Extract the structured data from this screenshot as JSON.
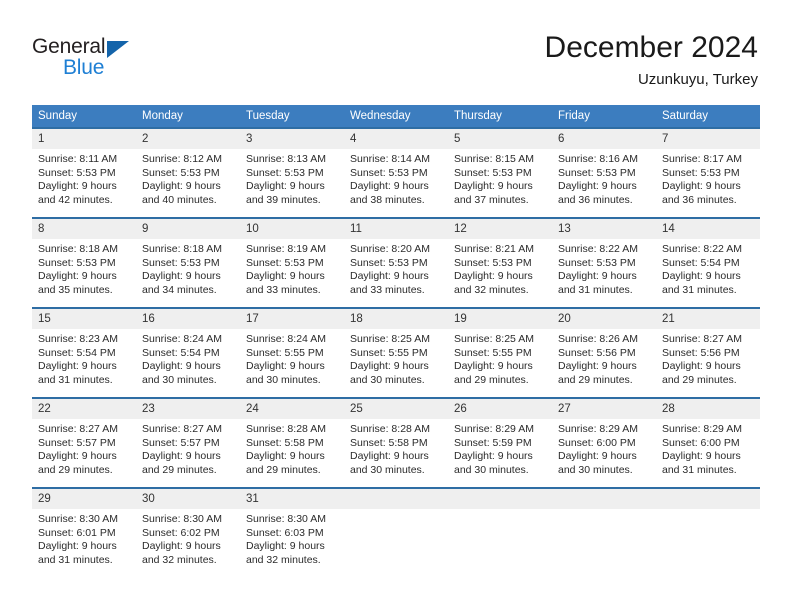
{
  "brand": {
    "name_top": "General",
    "name_bottom": "Blue",
    "accent_color": "#1e7fd4",
    "triangle_color": "#1464aa"
  },
  "header": {
    "title": "December 2024",
    "subtitle": "Uzunkuyu, Turkey"
  },
  "theme": {
    "header_bg": "#3c7dbf",
    "row_border": "#2e6da4",
    "daynum_bg": "#efefef"
  },
  "weekday_headers": [
    "Sunday",
    "Monday",
    "Tuesday",
    "Wednesday",
    "Thursday",
    "Friday",
    "Saturday"
  ],
  "weeks": [
    {
      "days": [
        {
          "num": "1",
          "sunrise": "Sunrise: 8:11 AM",
          "sunset": "Sunset: 5:53 PM",
          "daylight_line1": "Daylight: 9 hours",
          "daylight_line2": "and 42 minutes."
        },
        {
          "num": "2",
          "sunrise": "Sunrise: 8:12 AM",
          "sunset": "Sunset: 5:53 PM",
          "daylight_line1": "Daylight: 9 hours",
          "daylight_line2": "and 40 minutes."
        },
        {
          "num": "3",
          "sunrise": "Sunrise: 8:13 AM",
          "sunset": "Sunset: 5:53 PM",
          "daylight_line1": "Daylight: 9 hours",
          "daylight_line2": "and 39 minutes."
        },
        {
          "num": "4",
          "sunrise": "Sunrise: 8:14 AM",
          "sunset": "Sunset: 5:53 PM",
          "daylight_line1": "Daylight: 9 hours",
          "daylight_line2": "and 38 minutes."
        },
        {
          "num": "5",
          "sunrise": "Sunrise: 8:15 AM",
          "sunset": "Sunset: 5:53 PM",
          "daylight_line1": "Daylight: 9 hours",
          "daylight_line2": "and 37 minutes."
        },
        {
          "num": "6",
          "sunrise": "Sunrise: 8:16 AM",
          "sunset": "Sunset: 5:53 PM",
          "daylight_line1": "Daylight: 9 hours",
          "daylight_line2": "and 36 minutes."
        },
        {
          "num": "7",
          "sunrise": "Sunrise: 8:17 AM",
          "sunset": "Sunset: 5:53 PM",
          "daylight_line1": "Daylight: 9 hours",
          "daylight_line2": "and 36 minutes."
        }
      ]
    },
    {
      "days": [
        {
          "num": "8",
          "sunrise": "Sunrise: 8:18 AM",
          "sunset": "Sunset: 5:53 PM",
          "daylight_line1": "Daylight: 9 hours",
          "daylight_line2": "and 35 minutes."
        },
        {
          "num": "9",
          "sunrise": "Sunrise: 8:18 AM",
          "sunset": "Sunset: 5:53 PM",
          "daylight_line1": "Daylight: 9 hours",
          "daylight_line2": "and 34 minutes."
        },
        {
          "num": "10",
          "sunrise": "Sunrise: 8:19 AM",
          "sunset": "Sunset: 5:53 PM",
          "daylight_line1": "Daylight: 9 hours",
          "daylight_line2": "and 33 minutes."
        },
        {
          "num": "11",
          "sunrise": "Sunrise: 8:20 AM",
          "sunset": "Sunset: 5:53 PM",
          "daylight_line1": "Daylight: 9 hours",
          "daylight_line2": "and 33 minutes."
        },
        {
          "num": "12",
          "sunrise": "Sunrise: 8:21 AM",
          "sunset": "Sunset: 5:53 PM",
          "daylight_line1": "Daylight: 9 hours",
          "daylight_line2": "and 32 minutes."
        },
        {
          "num": "13",
          "sunrise": "Sunrise: 8:22 AM",
          "sunset": "Sunset: 5:53 PM",
          "daylight_line1": "Daylight: 9 hours",
          "daylight_line2": "and 31 minutes."
        },
        {
          "num": "14",
          "sunrise": "Sunrise: 8:22 AM",
          "sunset": "Sunset: 5:54 PM",
          "daylight_line1": "Daylight: 9 hours",
          "daylight_line2": "and 31 minutes."
        }
      ]
    },
    {
      "days": [
        {
          "num": "15",
          "sunrise": "Sunrise: 8:23 AM",
          "sunset": "Sunset: 5:54 PM",
          "daylight_line1": "Daylight: 9 hours",
          "daylight_line2": "and 31 minutes."
        },
        {
          "num": "16",
          "sunrise": "Sunrise: 8:24 AM",
          "sunset": "Sunset: 5:54 PM",
          "daylight_line1": "Daylight: 9 hours",
          "daylight_line2": "and 30 minutes."
        },
        {
          "num": "17",
          "sunrise": "Sunrise: 8:24 AM",
          "sunset": "Sunset: 5:55 PM",
          "daylight_line1": "Daylight: 9 hours",
          "daylight_line2": "and 30 minutes."
        },
        {
          "num": "18",
          "sunrise": "Sunrise: 8:25 AM",
          "sunset": "Sunset: 5:55 PM",
          "daylight_line1": "Daylight: 9 hours",
          "daylight_line2": "and 30 minutes."
        },
        {
          "num": "19",
          "sunrise": "Sunrise: 8:25 AM",
          "sunset": "Sunset: 5:55 PM",
          "daylight_line1": "Daylight: 9 hours",
          "daylight_line2": "and 29 minutes."
        },
        {
          "num": "20",
          "sunrise": "Sunrise: 8:26 AM",
          "sunset": "Sunset: 5:56 PM",
          "daylight_line1": "Daylight: 9 hours",
          "daylight_line2": "and 29 minutes."
        },
        {
          "num": "21",
          "sunrise": "Sunrise: 8:27 AM",
          "sunset": "Sunset: 5:56 PM",
          "daylight_line1": "Daylight: 9 hours",
          "daylight_line2": "and 29 minutes."
        }
      ]
    },
    {
      "days": [
        {
          "num": "22",
          "sunrise": "Sunrise: 8:27 AM",
          "sunset": "Sunset: 5:57 PM",
          "daylight_line1": "Daylight: 9 hours",
          "daylight_line2": "and 29 minutes."
        },
        {
          "num": "23",
          "sunrise": "Sunrise: 8:27 AM",
          "sunset": "Sunset: 5:57 PM",
          "daylight_line1": "Daylight: 9 hours",
          "daylight_line2": "and 29 minutes."
        },
        {
          "num": "24",
          "sunrise": "Sunrise: 8:28 AM",
          "sunset": "Sunset: 5:58 PM",
          "daylight_line1": "Daylight: 9 hours",
          "daylight_line2": "and 29 minutes."
        },
        {
          "num": "25",
          "sunrise": "Sunrise: 8:28 AM",
          "sunset": "Sunset: 5:58 PM",
          "daylight_line1": "Daylight: 9 hours",
          "daylight_line2": "and 30 minutes."
        },
        {
          "num": "26",
          "sunrise": "Sunrise: 8:29 AM",
          "sunset": "Sunset: 5:59 PM",
          "daylight_line1": "Daylight: 9 hours",
          "daylight_line2": "and 30 minutes."
        },
        {
          "num": "27",
          "sunrise": "Sunrise: 8:29 AM",
          "sunset": "Sunset: 6:00 PM",
          "daylight_line1": "Daylight: 9 hours",
          "daylight_line2": "and 30 minutes."
        },
        {
          "num": "28",
          "sunrise": "Sunrise: 8:29 AM",
          "sunset": "Sunset: 6:00 PM",
          "daylight_line1": "Daylight: 9 hours",
          "daylight_line2": "and 31 minutes."
        }
      ]
    },
    {
      "days": [
        {
          "num": "29",
          "sunrise": "Sunrise: 8:30 AM",
          "sunset": "Sunset: 6:01 PM",
          "daylight_line1": "Daylight: 9 hours",
          "daylight_line2": "and 31 minutes."
        },
        {
          "num": "30",
          "sunrise": "Sunrise: 8:30 AM",
          "sunset": "Sunset: 6:02 PM",
          "daylight_line1": "Daylight: 9 hours",
          "daylight_line2": "and 32 minutes."
        },
        {
          "num": "31",
          "sunrise": "Sunrise: 8:30 AM",
          "sunset": "Sunset: 6:03 PM",
          "daylight_line1": "Daylight: 9 hours",
          "daylight_line2": "and 32 minutes."
        },
        {
          "num": "",
          "sunrise": "",
          "sunset": "",
          "daylight_line1": "",
          "daylight_line2": ""
        },
        {
          "num": "",
          "sunrise": "",
          "sunset": "",
          "daylight_line1": "",
          "daylight_line2": ""
        },
        {
          "num": "",
          "sunrise": "",
          "sunset": "",
          "daylight_line1": "",
          "daylight_line2": ""
        },
        {
          "num": "",
          "sunrise": "",
          "sunset": "",
          "daylight_line1": "",
          "daylight_line2": ""
        }
      ]
    }
  ]
}
